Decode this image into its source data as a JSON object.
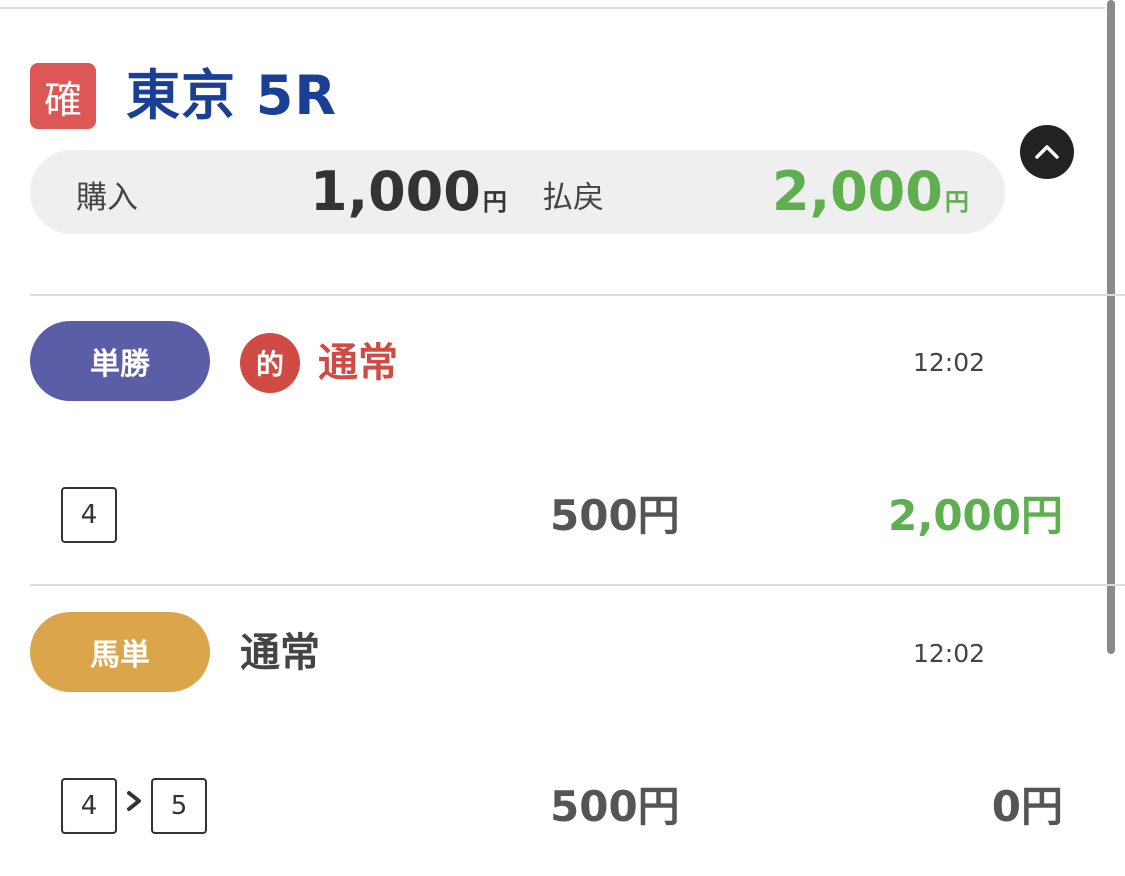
{
  "header": {
    "status_badge": "確",
    "race_title": "東京 5R"
  },
  "summary": {
    "purchase_label": "購入",
    "purchase_amount": "1,000",
    "purchase_unit": "円",
    "payout_label": "払戻",
    "payout_amount": "2,000",
    "payout_unit": "円"
  },
  "bets": [
    {
      "type_label": "単勝",
      "type_color": "#5b5ea6",
      "hit_badge": "的",
      "method": "通常",
      "method_color": "#d14b45",
      "time": "12:02",
      "numbers": [
        "4"
      ],
      "stake": "500円",
      "payout": "2,000円",
      "payout_color": "#5fae4f"
    },
    {
      "type_label": "馬単",
      "type_color": "#dba64b",
      "method": "通常",
      "method_color": "#444444",
      "time": "12:02",
      "numbers": [
        "4",
        "5"
      ],
      "stake": "500円",
      "payout": "0円",
      "payout_color": "#555555"
    }
  ],
  "colors": {
    "title": "#1c3f96",
    "badge": "#dd5757",
    "hit": "#5fae4f"
  }
}
